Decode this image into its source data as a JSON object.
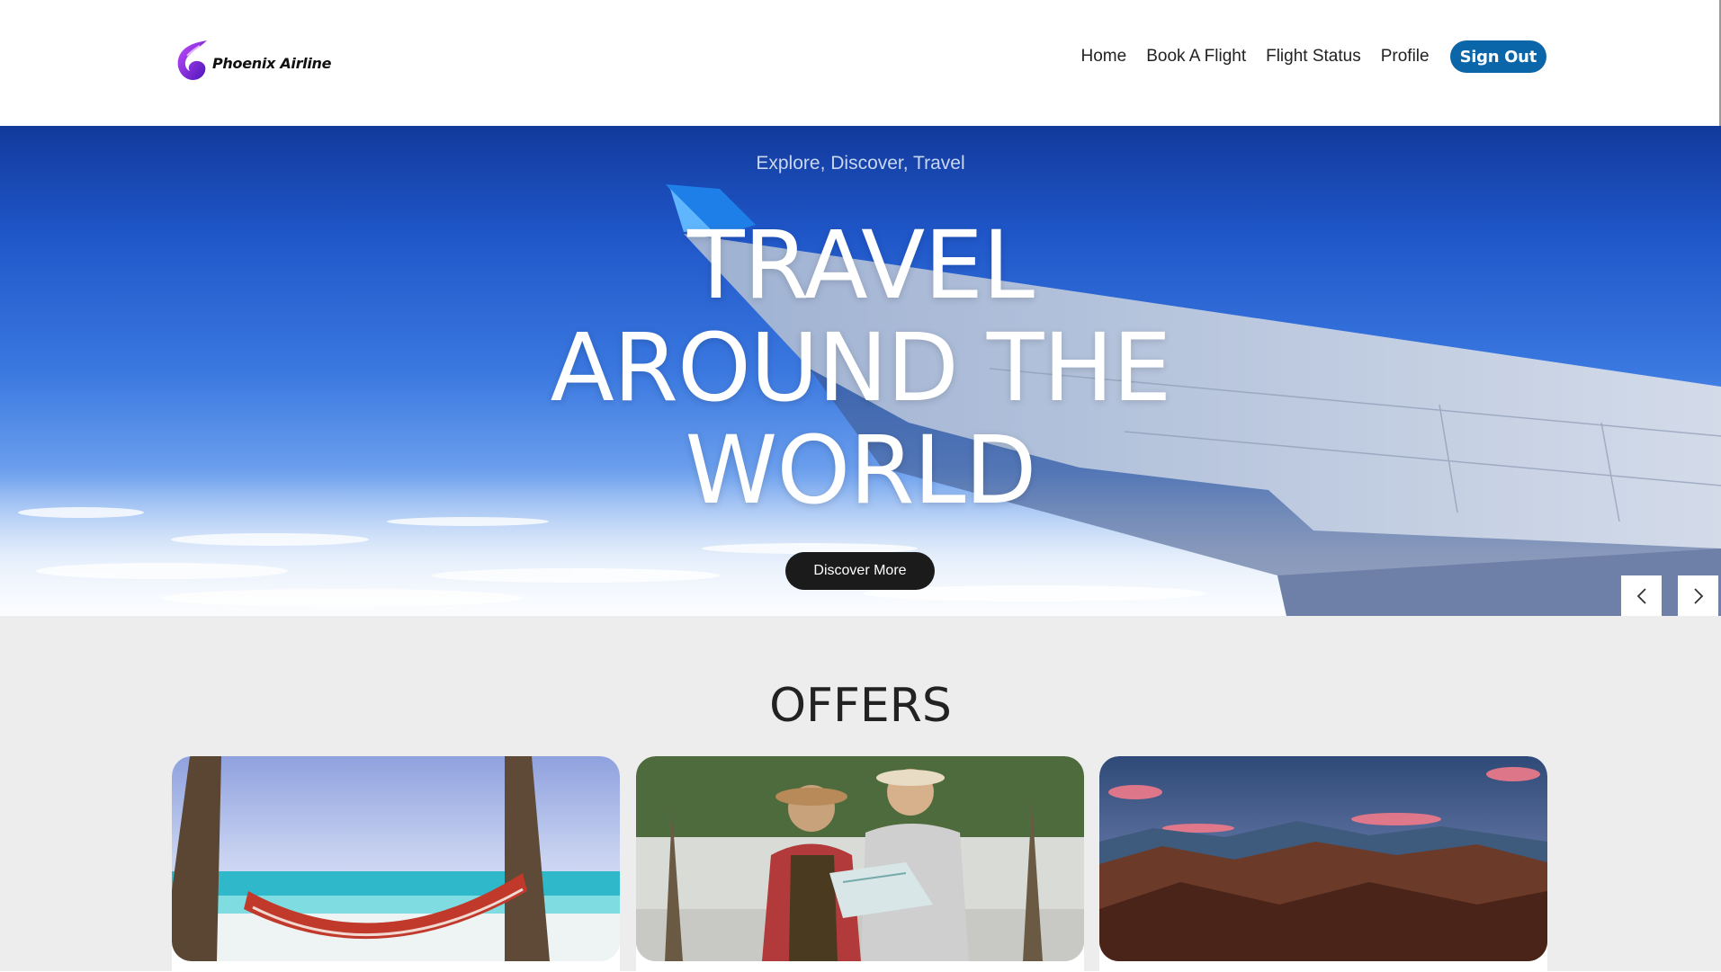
{
  "brand": {
    "name": "Phoenix Airline"
  },
  "nav": {
    "items": [
      {
        "label": "Home"
      },
      {
        "label": "Book A Flight"
      },
      {
        "label": "Flight Status"
      },
      {
        "label": "Profile"
      }
    ],
    "signout_label": "Sign Out"
  },
  "hero": {
    "subtitle": "Explore, Discover, Travel",
    "title_line1": "TRAVEL",
    "title_line2": "AROUND THE",
    "title_line3": "WORLD",
    "cta_label": "Discover More",
    "prev_icon": "chevron-left-icon",
    "next_icon": "chevron-right-icon"
  },
  "offers": {
    "title": "OFFERS",
    "cards": [
      {
        "image": "beach-hammock-image"
      },
      {
        "image": "travelers-map-image"
      },
      {
        "image": "mountain-sunset-image"
      }
    ]
  },
  "colors": {
    "accent": "#0a66a8",
    "brand_gradient_start": "#a13cff",
    "brand_gradient_end": "#5a1fd1",
    "cta_bg": "#1b1b1b",
    "section_bg": "#ededed"
  }
}
